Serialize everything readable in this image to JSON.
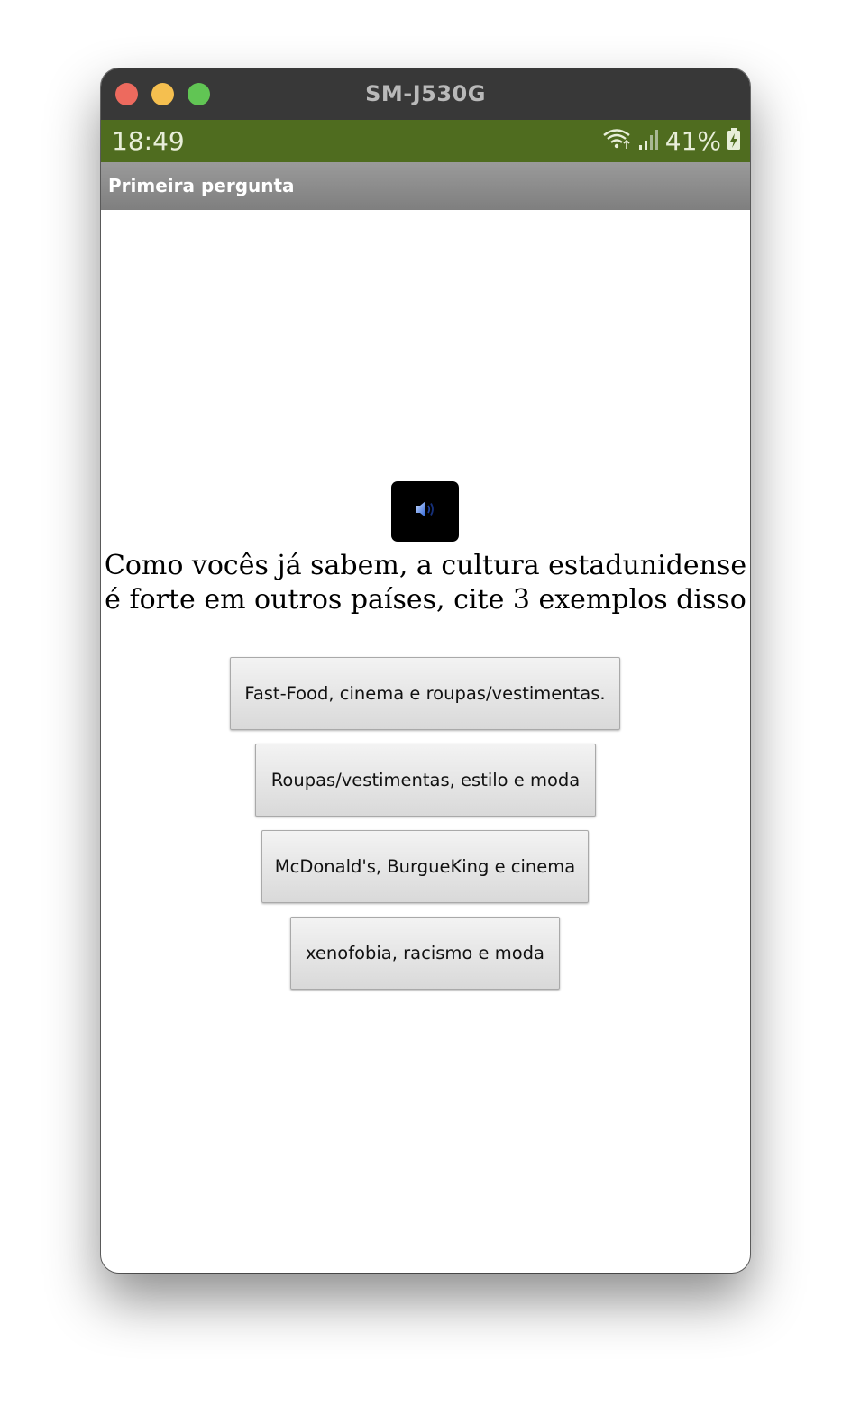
{
  "window": {
    "title": "SM-J530G"
  },
  "status_bar": {
    "time": "18:49",
    "battery": "41%",
    "icons": [
      "wifi-icon",
      "signal-icon",
      "battery-charging-icon"
    ]
  },
  "app_bar": {
    "title": "Primeira pergunta"
  },
  "sound_button": {
    "icon": "speaker-icon"
  },
  "question": {
    "line1": "Como vocês já sabem, a cultura estadunidense",
    "line2": "é forte em outros países, cite 3 exemplos disso"
  },
  "answers": [
    "Fast-Food, cinema e roupas/vestimentas.",
    "Roupas/vestimentas, estilo e moda",
    "McDonald's, BurgueKing e cinema",
    "xenofobia, racismo e moda"
  ],
  "colors": {
    "status_bar": "#4f6c1f",
    "app_bar": "#8c8c8c",
    "title_bar": "#383838"
  }
}
